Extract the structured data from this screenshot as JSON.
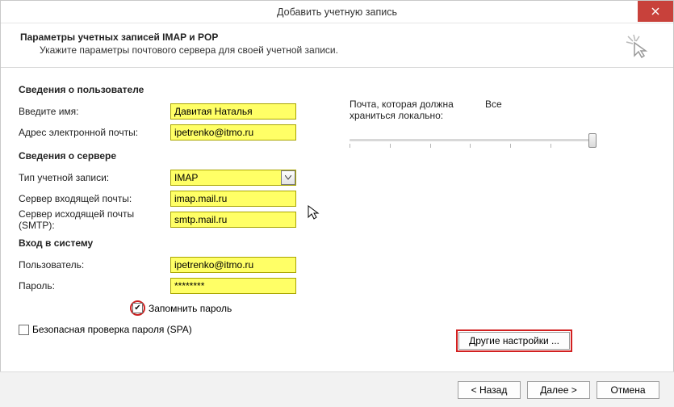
{
  "window": {
    "title": "Добавить учетную запись"
  },
  "header": {
    "title": "Параметры учетных записей IMAP и POP",
    "subtitle": "Укажите параметры почтового сервера для своей учетной записи."
  },
  "sections": {
    "user_info": "Сведения о пользователе",
    "server_info": "Сведения о сервере",
    "login": "Вход в систему"
  },
  "labels": {
    "name": "Введите имя:",
    "email": "Адрес электронной почты:",
    "account_type": "Тип учетной записи:",
    "incoming": "Сервер входящей почты:",
    "outgoing": "Сервер исходящей почты (SMTP):",
    "user": "Пользователь:",
    "password": "Пароль:",
    "remember": "Запомнить пароль",
    "spa": "Безопасная проверка пароля (SPA)"
  },
  "values": {
    "name": "Давитая Наталья",
    "email": "ipetrenko@itmo.ru",
    "account_type": "IMAP",
    "incoming": "imap.mail.ru",
    "outgoing": "smtp.mail.ru",
    "user": "ipetrenko@itmo.ru",
    "password": "********",
    "remember_checked": "✔"
  },
  "slider": {
    "label_left": "Почта, которая должна храниться локально:",
    "label_right": "Все"
  },
  "buttons": {
    "more": "Другие настройки ...",
    "back": "< Назад",
    "next": "Далее >",
    "cancel": "Отмена"
  }
}
